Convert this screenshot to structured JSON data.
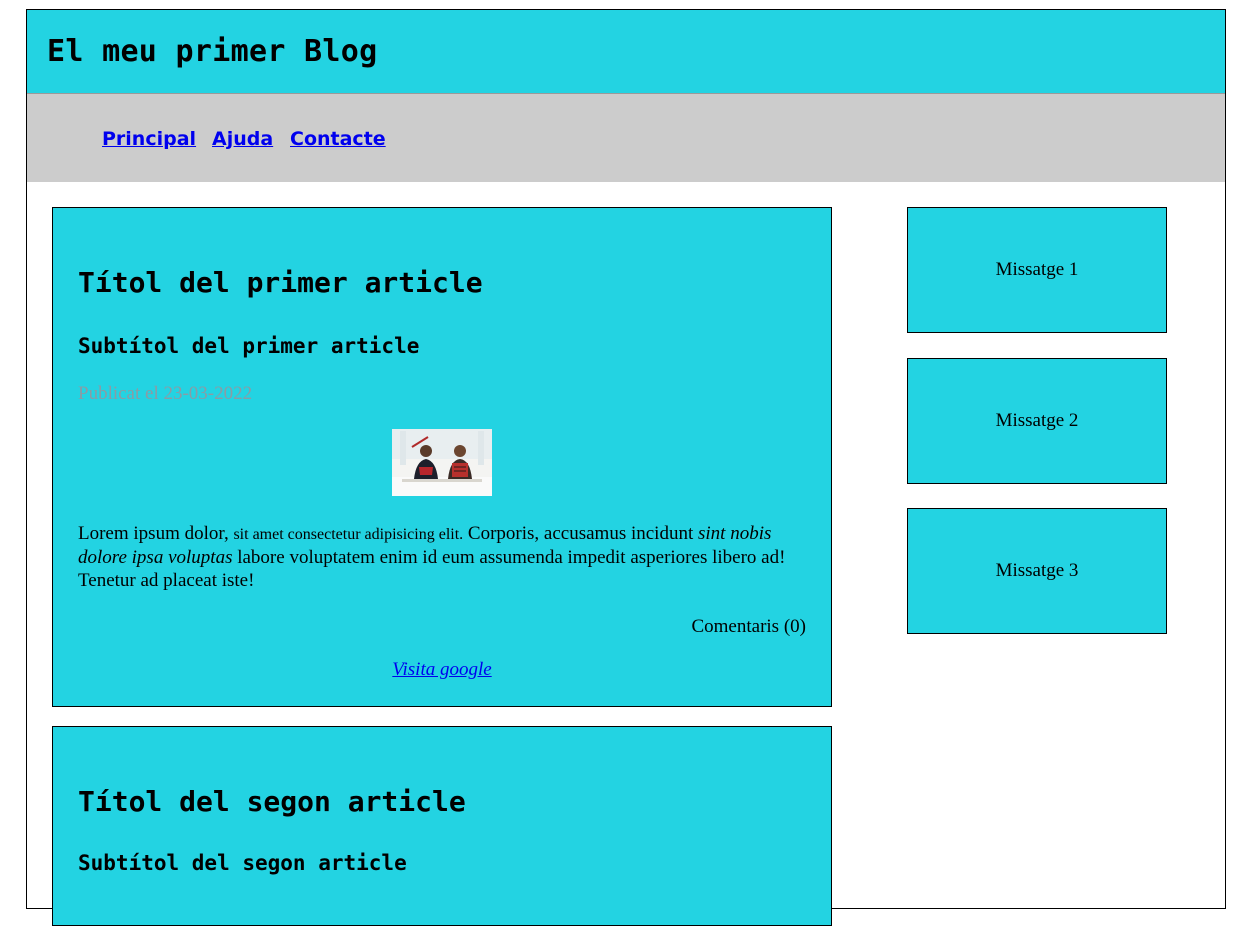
{
  "header": {
    "title": "El meu primer Blog"
  },
  "nav": {
    "items": [
      {
        "label": "Principal"
      },
      {
        "label": "Ajuda"
      },
      {
        "label": "Contacte"
      }
    ]
  },
  "articles": [
    {
      "title": "Títol del primer article",
      "subtitle": "Subtítol del primer article",
      "date": "Publicat el 23-03-2022",
      "image_alt": "two-people-at-table-photo",
      "body": {
        "part1": "Lorem ipsum dolor, ",
        "part2_small": "sit amet consectetur adipisicing elit.",
        "part3": " Corporis, accusamus incidunt ",
        "part4_italic": "sint nobis dolore ipsa voluptas",
        "part5": " labore voluptatem enim id eum assumenda impedit asperiores libero ad! Tenetur ad placeat iste!"
      },
      "comments": "Comentaris (0)",
      "link": "Visita google"
    },
    {
      "title": "Títol del segon article",
      "subtitle": "Subtítol del segon article"
    }
  ],
  "sidebar": {
    "messages": [
      {
        "label": "Missatge 1"
      },
      {
        "label": "Missatge 2"
      },
      {
        "label": "Missatge 3"
      }
    ]
  },
  "colors": {
    "accent": "#23d3e2",
    "nav_bg": "#cccccc",
    "link": "#0000ee",
    "date": "#8a9ca5"
  }
}
